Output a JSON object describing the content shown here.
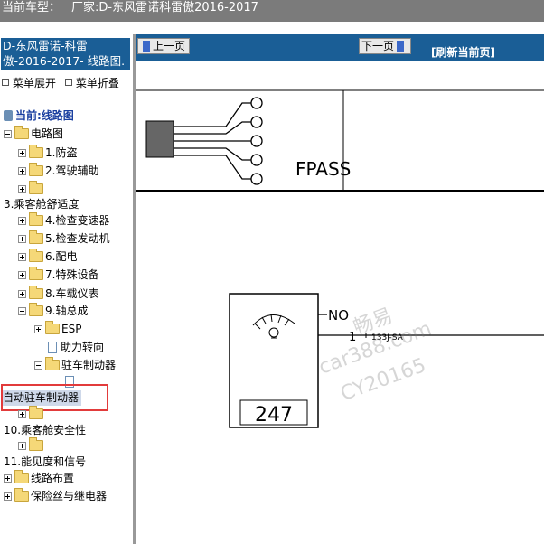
{
  "topbar": {
    "label": "当前车型：",
    "value": "厂家:D-东风雷诺科雷傲2016-2017"
  },
  "sidebar": {
    "title": "D-东风雷诺-科雷傲-2016-2017- 线路图.",
    "expand_label": "菜单展开",
    "collapse_label": "菜单折叠",
    "current_label": "当前:线路图",
    "items": [
      {
        "label": "电路图"
      },
      {
        "label": "1.防盗"
      },
      {
        "label": "2.驾驶辅助"
      },
      {
        "label": ""
      },
      {
        "label": "3.乘客舱舒适度"
      },
      {
        "label": "4.检查变速器"
      },
      {
        "label": "5.检查发动机"
      },
      {
        "label": "6.配电"
      },
      {
        "label": "7.特殊设备"
      },
      {
        "label": "8.车载仪表"
      },
      {
        "label": "9.轴总成"
      },
      {
        "label": "ESP"
      },
      {
        "label": "助力转向"
      },
      {
        "label": "驻车制动器"
      },
      {
        "label": "自动驻车制动器"
      },
      {
        "label": "10.乘客舱安全性"
      },
      {
        "label": "11.能见度和信号"
      },
      {
        "label": "线路布置"
      },
      {
        "label": "保险丝与继电器"
      }
    ]
  },
  "nav": {
    "prev_label": "上一页",
    "next_label": "下一页",
    "refresh_label": "[刷新当前页]"
  },
  "diagram": {
    "fpass_label": "FPASS",
    "component_number": "247",
    "no_label": "NO",
    "pin_label": "1",
    "wire_label": "133J-SA"
  },
  "watermark": {
    "line1": "畅易",
    "line2": "car388.com",
    "line3": "CY20165"
  },
  "colors": {
    "topbar_bg": "#7b7b7b",
    "nav_bg": "#1a5e96",
    "highlight": "#e23b3b"
  }
}
